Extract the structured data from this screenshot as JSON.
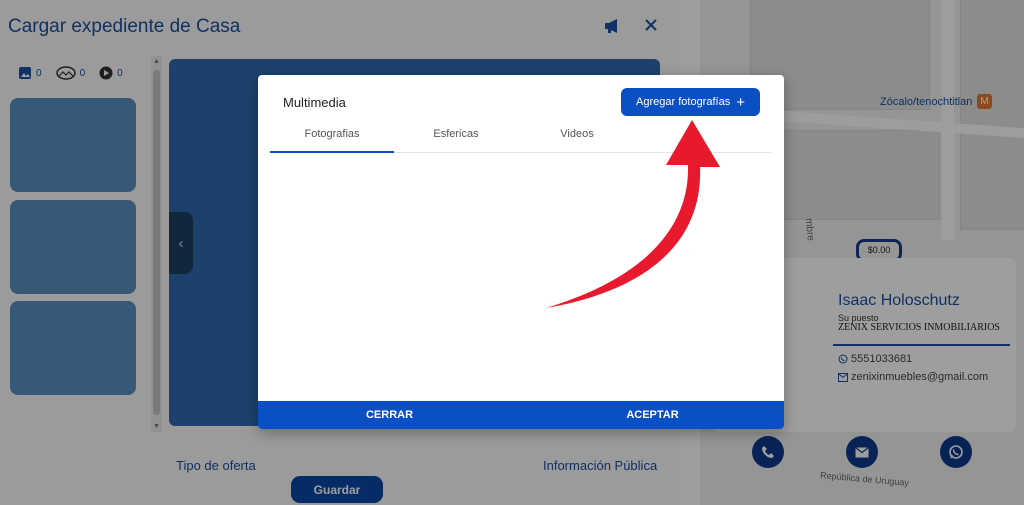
{
  "panel": {
    "title": "Cargar expediente de Casa",
    "counts": {
      "photos": "0",
      "panoramas": "0",
      "videos": "0"
    },
    "footer": {
      "offer_type_label": "Tipo de oferta",
      "public_info_label": "Información Pública",
      "save_label": "Guardar"
    }
  },
  "map": {
    "metro_label": "Zócalo/tenochtitlan",
    "street_label_1": "mbre",
    "street_label_2": "República de Uruguay",
    "price_label": "$0.00"
  },
  "agent": {
    "name": "Isaac Holoschutz",
    "role": "Su puesto",
    "company": "ZENIX SERVICIOS INMOBILIARIOS",
    "phone": "5551033681",
    "email": "zenixinmuebles@gmail.com"
  },
  "modal": {
    "title": "Multimedia",
    "add_button_label": "Agregar fotografías",
    "tabs": [
      {
        "label": "Fotografias"
      },
      {
        "label": "Esfericas"
      },
      {
        "label": "Videos"
      }
    ],
    "cancel_label": "CERRAR",
    "accept_label": "ACEPTAR"
  },
  "colors": {
    "accent": "#0a4fc4",
    "title_blue": "#1a4fa3",
    "arrow": "#e8192c"
  }
}
